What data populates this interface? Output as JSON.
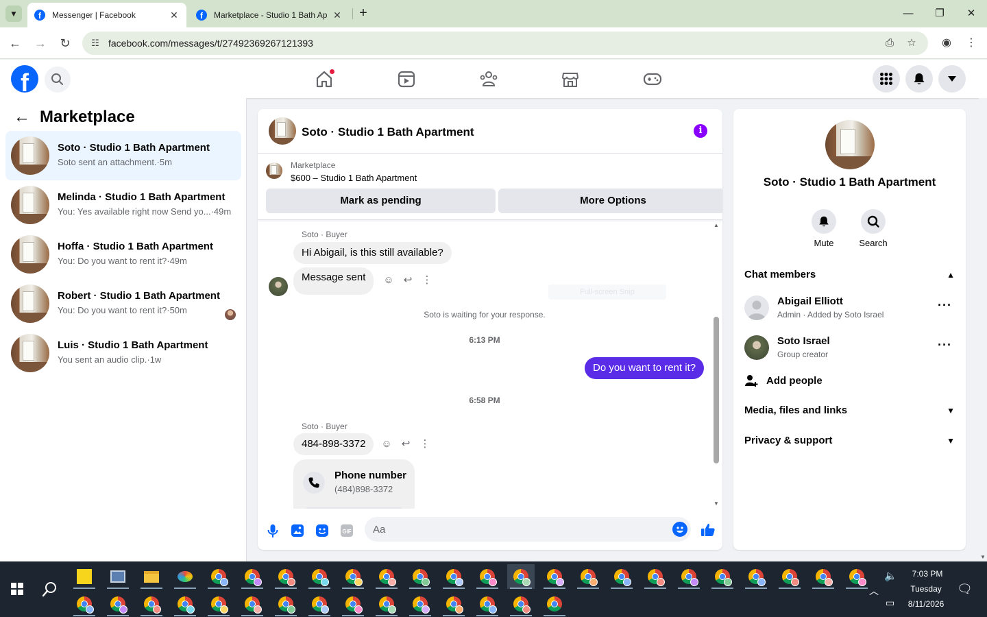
{
  "browser": {
    "tabs": [
      {
        "title": "Messenger | Facebook",
        "active": true
      },
      {
        "title": "Marketplace - Studio 1 Bath Ap",
        "active": false
      }
    ],
    "url": "facebook.com/messages/t/27492369267121393"
  },
  "sidebar": {
    "title": "Marketplace",
    "conversations": [
      {
        "name": "Soto · Studio 1 Bath Apartment",
        "preview": "Soto sent an attachment.",
        "time": "5m"
      },
      {
        "name": "Melinda · Studio 1 Bath Apartment",
        "preview": "You: Yes available right now Send yo...",
        "time": "49m"
      },
      {
        "name": "Hoffa · Studio 1 Bath Apartment",
        "preview": "You: Do you want to rent it?",
        "time": "49m"
      },
      {
        "name": "Robert · Studio 1 Bath Apartment",
        "preview": "You: Do you want to rent it?",
        "time": "50m"
      },
      {
        "name": "Luis · Studio 1 Bath Apartment",
        "preview": "You sent an audio clip.",
        "time": "1w"
      }
    ]
  },
  "chat": {
    "title": "Soto · Studio 1 Bath Apartment",
    "marketplace_label": "Marketplace",
    "listing": "$600 – Studio 1 Bath Apartment",
    "btn_pending": "Mark as pending",
    "btn_more": "More Options",
    "sender_label": "Soto · Buyer",
    "msg1": "Hi Abigail, is this still available?",
    "msg2": "Message sent",
    "ghost": "Full-screen Snip",
    "waiting": "Soto is waiting for your response.",
    "time1": "6:13 PM",
    "out1": "Do you want to rent it?",
    "time2": "6:58 PM",
    "msg3": "484-898-3372",
    "card_title": "Phone number",
    "card_sub": "(484)898-3372",
    "composer_placeholder": "Aa"
  },
  "info": {
    "name": "Soto · Studio 1 Bath Apartment",
    "mute": "Mute",
    "search": "Search",
    "chat_members": "Chat members",
    "members": [
      {
        "name": "Abigail Elliott",
        "role": "Admin · Added by Soto Israel"
      },
      {
        "name": "Soto Israel",
        "role": "Group creator"
      }
    ],
    "add_people": "Add people",
    "media": "Media, files and links",
    "privacy": "Privacy & support"
  },
  "taskbar": {
    "time": "7:03 PM",
    "day": "Tuesday",
    "date": "8/11/2026"
  },
  "colors": {
    "fb_blue": "#0866ff",
    "outgoing_bubble": "#5b2ce8",
    "selected_row": "#ebf5ff",
    "notification_dot": "#e41e3f"
  }
}
